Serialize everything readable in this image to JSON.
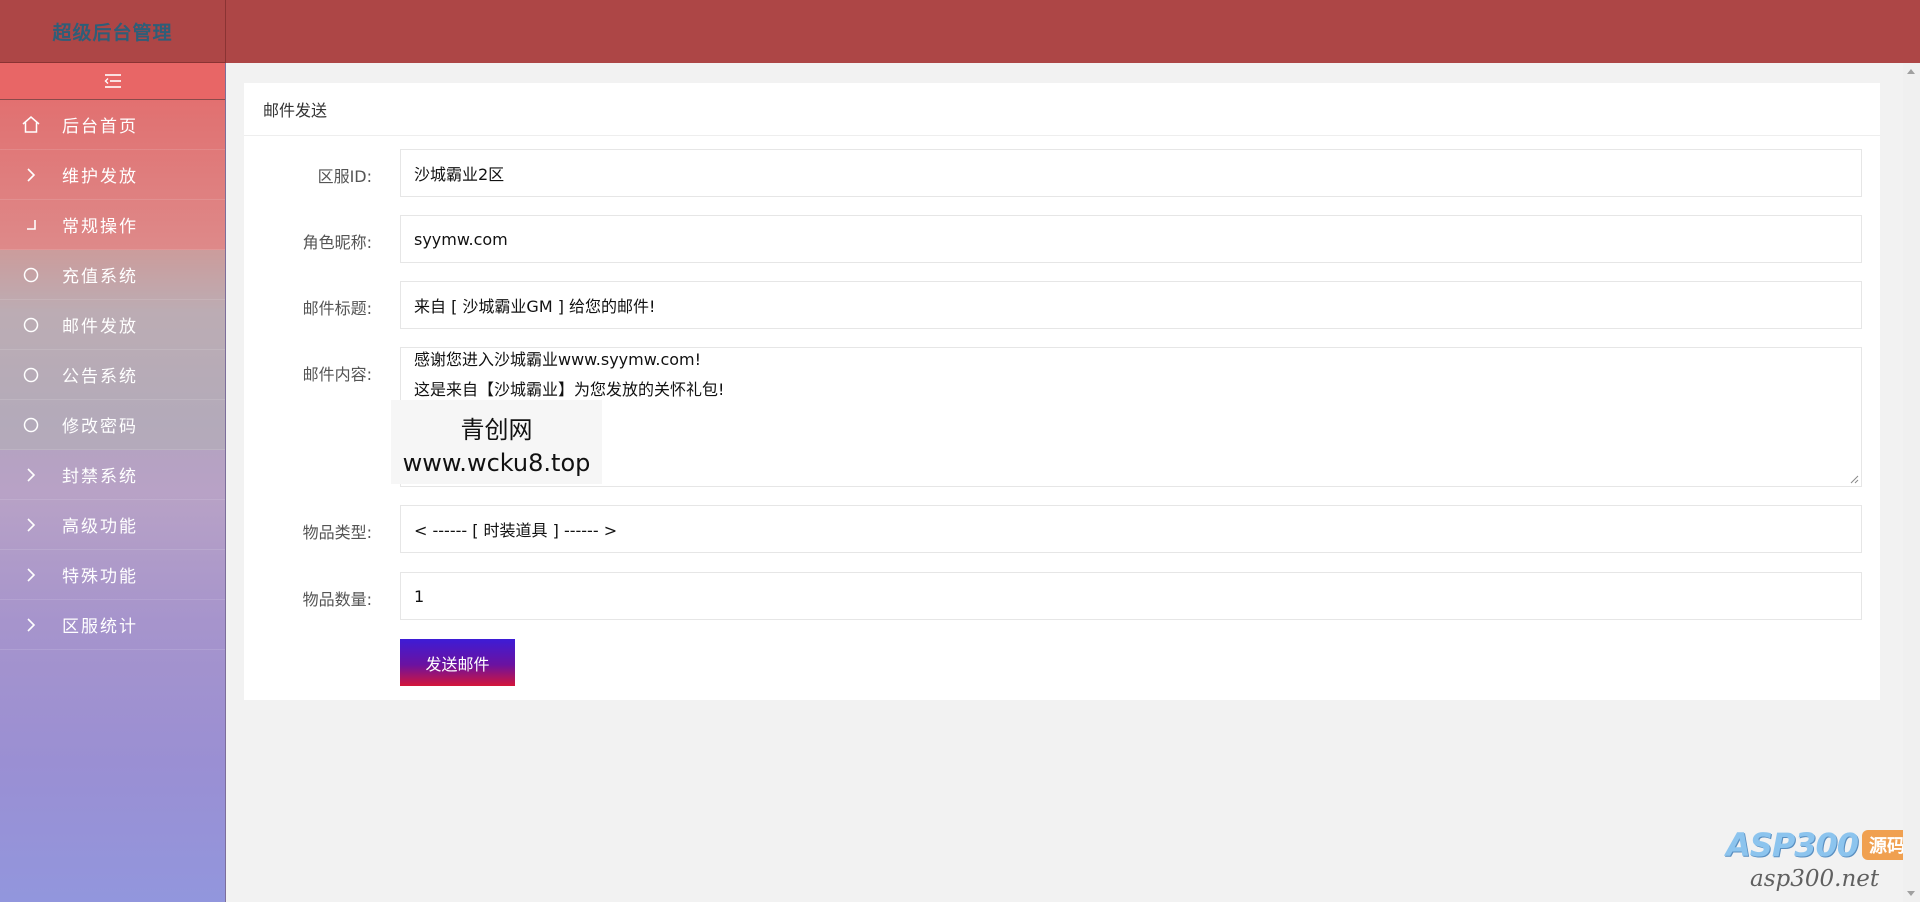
{
  "app": {
    "title": "超级后台管理"
  },
  "sidebar": {
    "toggle_icon": "menu-collapse-icon",
    "items": [
      {
        "label": "后台首页",
        "icon": "home-icon"
      },
      {
        "label": "维护发放",
        "icon": "chevron-right-icon"
      },
      {
        "label": "常规操作",
        "icon": "corner-icon"
      },
      {
        "label": "充值系统",
        "icon": "circle-icon"
      },
      {
        "label": "邮件发放",
        "icon": "circle-icon"
      },
      {
        "label": "公告系统",
        "icon": "circle-icon"
      },
      {
        "label": "修改密码",
        "icon": "circle-icon"
      },
      {
        "label": "封禁系统",
        "icon": "chevron-right-icon"
      },
      {
        "label": "高级功能",
        "icon": "chevron-right-icon"
      },
      {
        "label": "特殊功能",
        "icon": "chevron-right-icon"
      },
      {
        "label": "区服统计",
        "icon": "chevron-right-icon"
      }
    ]
  },
  "card": {
    "title": "邮件发送"
  },
  "form": {
    "server": {
      "label": "区服ID:",
      "value": "沙城霸业2区"
    },
    "role": {
      "label": "角色昵称:",
      "value": "syymw.com"
    },
    "mail_title": {
      "label": "邮件标题:",
      "value": "来自 [ 沙城霸业GM ] 给您的邮件!"
    },
    "mail_content": {
      "label": "邮件内容:",
      "line1": "感谢您进入沙城霸业www.syymw.com!",
      "line2": "这是来自【沙城霸业】为您发放的关怀礼包!"
    },
    "item_type": {
      "label": "物品类型:",
      "value": "< ------ [ 时装道具 ] ------ >"
    },
    "item_count": {
      "label": "物品数量:",
      "value": "1"
    },
    "submit_label": "发送邮件"
  },
  "overlay": {
    "line1": "青创网",
    "line2": "www.wcku8.top"
  },
  "watermark": {
    "brand": "ASP300",
    "badge": "源码",
    "url": "asp300.net"
  },
  "colors": {
    "topbar": "#ad4646",
    "submit_start": "#3d1cd6",
    "submit_end": "#d4153a"
  }
}
